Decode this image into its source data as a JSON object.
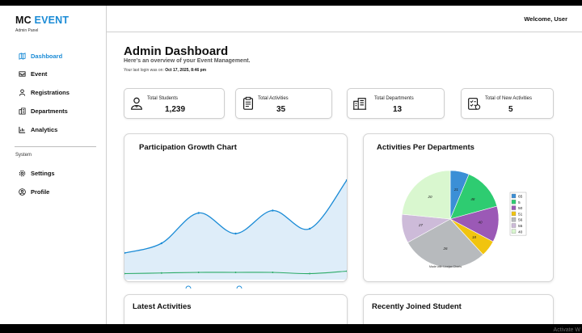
{
  "brand": {
    "name_part1": "MC",
    "name_part2": "EVENT",
    "subtitle": "Admin Panel"
  },
  "sidebar": {
    "items": [
      {
        "label": "Dashboard",
        "icon": "map-icon",
        "active": true
      },
      {
        "label": "Event",
        "icon": "inbox-icon"
      },
      {
        "label": "Registrations",
        "icon": "user-icon"
      },
      {
        "label": "Departments",
        "icon": "building-icon"
      },
      {
        "label": "Analytics",
        "icon": "chart-icon"
      }
    ],
    "system_label": "System",
    "system_items": [
      {
        "label": "Settings",
        "icon": "gear-icon"
      },
      {
        "label": "Profile",
        "icon": "user-circle-icon"
      }
    ]
  },
  "header": {
    "welcome": "Welcome, User"
  },
  "main": {
    "title": "Admin Dashboard",
    "subtitle": "Here's an overview of your Event Management.",
    "login_prefix": "Your last login was on:",
    "login_time": "Oct 17, 2025, 8:46 pm"
  },
  "stats": [
    {
      "label": "Total Students",
      "value": "1,239",
      "icon": "students-icon"
    },
    {
      "label": "Total Activities",
      "value": "35",
      "icon": "clipboard-icon"
    },
    {
      "label": "Total Departments",
      "value": "13",
      "icon": "building-icon"
    },
    {
      "label": "Total of New Activities",
      "value": "5",
      "icon": "checklist-icon"
    }
  ],
  "panels": {
    "growth_title": "Participation Growth Chart",
    "departments_title": "Activities Per Departments",
    "pie_footnote": "Made with Livejax Charts",
    "latest_title": "Latest Activities",
    "joined_title": "Recently Joined Student"
  },
  "watermark": "Activate W",
  "colors": {
    "accent": "#1a8bd6",
    "area_fill": "#deedf9",
    "green_line": "#2aaa66"
  },
  "chart_data": [
    {
      "type": "area",
      "title": "Participation Growth Chart",
      "series": [
        {
          "values": [
            22,
            30,
            55,
            38,
            57,
            42,
            82
          ]
        },
        {
          "values": [
            5,
            5.5,
            6,
            6,
            6,
            5,
            7
          ]
        }
      ],
      "ylim": [
        0,
        100
      ],
      "grid": false
    },
    {
      "type": "pie",
      "title": "Activities Per Departments",
      "slices": [
        {
          "label": "21",
          "value": 21,
          "color": "#3b8fd6"
        },
        {
          "label": "48",
          "value": 48,
          "color": "#2ecc71"
        },
        {
          "label": "40",
          "value": 40,
          "color": "#9b59b6"
        },
        {
          "label": "18",
          "value": 18,
          "color": "#f1c40f"
        },
        {
          "label": "26",
          "value": 96,
          "color": "#b7babd"
        },
        {
          "label": "27",
          "value": 32,
          "color": "#cdbbd9"
        },
        {
          "label": "20",
          "value": 78,
          "color": "#d9f7cf"
        }
      ],
      "legend": [
        "65",
        "5",
        "50",
        "51",
        "56",
        "55",
        "40"
      ],
      "legend_placement": "right"
    }
  ]
}
